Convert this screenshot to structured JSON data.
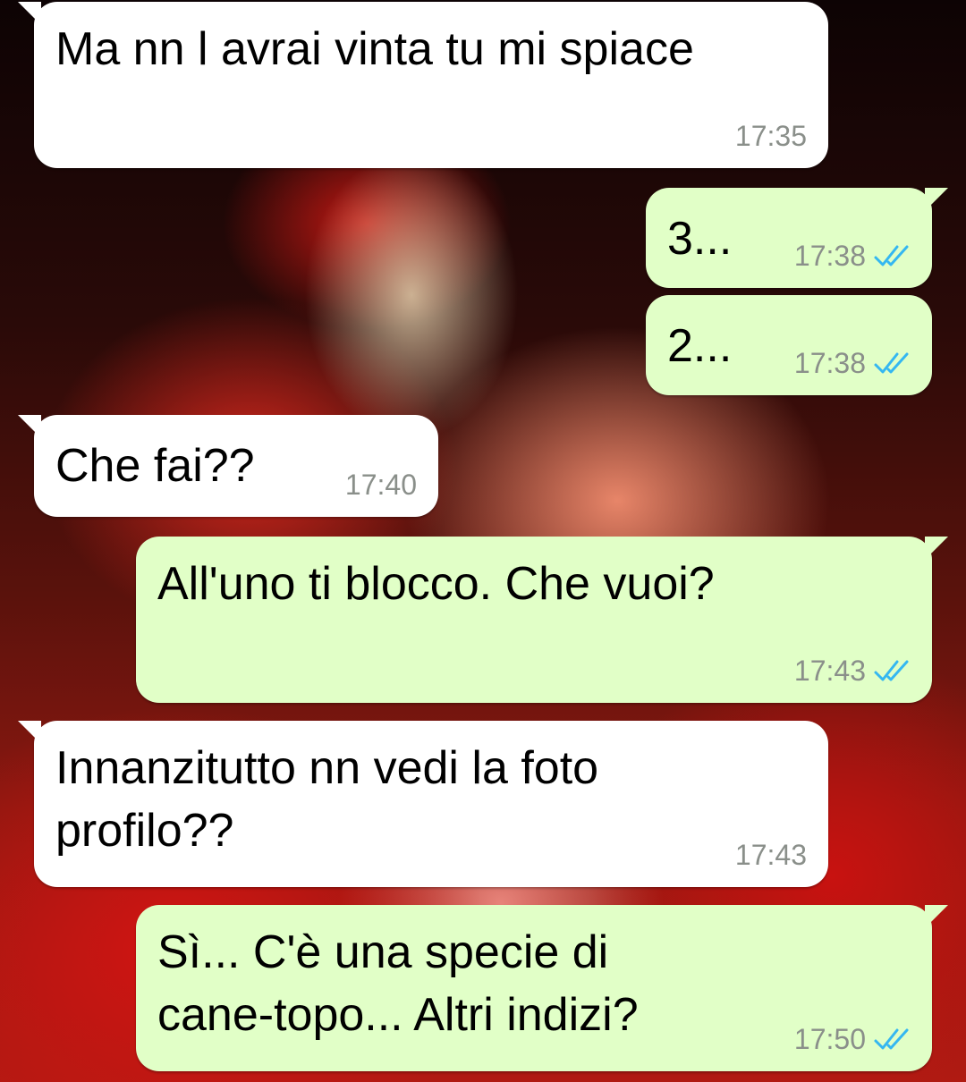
{
  "messages": [
    {
      "direction": "incoming",
      "text": "Ma nn l avrai vinta tu mi spiace",
      "time": "17:35"
    },
    {
      "direction": "outgoing",
      "text": "3...",
      "time": "17:38",
      "status": "read-double-check-icon"
    },
    {
      "direction": "outgoing",
      "text": "2...",
      "time": "17:38",
      "status": "read-double-check-icon"
    },
    {
      "direction": "incoming",
      "text": "Che fai??",
      "time": "17:40"
    },
    {
      "direction": "outgoing",
      "text": "All'uno ti blocco. Che vuoi?",
      "time": "17:43",
      "status": "read-double-check-icon"
    },
    {
      "direction": "incoming",
      "text": "Innanzitutto nn vedi la foto\nprofilo??",
      "time": "17:43"
    },
    {
      "direction": "outgoing",
      "text": "Sì... C'è una specie di\ncane-topo... Altri indizi?",
      "time": "17:50",
      "status": "read-double-check-icon"
    }
  ],
  "colors": {
    "incoming_bubble": "#ffffff",
    "outgoing_bubble": "#e1ffc7",
    "timestamp": "#8a8f8a",
    "read_ticks": "#34b7f1"
  }
}
